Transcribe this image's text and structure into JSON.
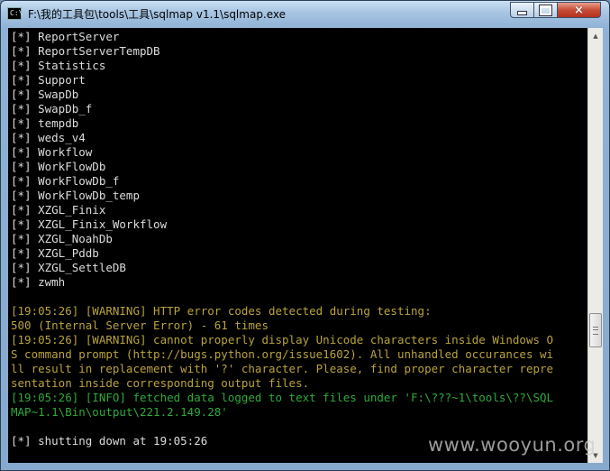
{
  "window": {
    "title": "F:\\我的工具包\\tools\\工具\\sqlmap v1.1\\sqlmap.exe",
    "icon_text": "C:\\",
    "buttons": {
      "minimize": "minimize-icon",
      "maximize": "maximize-icon",
      "close": "×"
    }
  },
  "console": {
    "lines": [
      {
        "text": "[*] ReportServer",
        "type": "normal"
      },
      {
        "text": "[*] ReportServerTempDB",
        "type": "normal"
      },
      {
        "text": "[*] Statistics",
        "type": "normal"
      },
      {
        "text": "[*] Support",
        "type": "normal"
      },
      {
        "text": "[*] SwapDb",
        "type": "normal"
      },
      {
        "text": "[*] SwapDb_f",
        "type": "normal"
      },
      {
        "text": "[*] tempdb",
        "type": "normal"
      },
      {
        "text": "[*] weds_v4",
        "type": "normal"
      },
      {
        "text": "[*] Workflow",
        "type": "normal"
      },
      {
        "text": "[*] WorkFlowDb",
        "type": "normal"
      },
      {
        "text": "[*] WorkFlowDb_f",
        "type": "normal"
      },
      {
        "text": "[*] WorkFlowDb_temp",
        "type": "normal"
      },
      {
        "text": "[*] XZGL_Finix",
        "type": "normal"
      },
      {
        "text": "[*] XZGL_Finix_Workflow",
        "type": "normal"
      },
      {
        "text": "[*] XZGL_NoahDb",
        "type": "normal"
      },
      {
        "text": "[*] XZGL_Pddb",
        "type": "normal"
      },
      {
        "text": "[*] XZGL_SettleDB",
        "type": "normal"
      },
      {
        "text": "[*] zwmh",
        "type": "normal"
      },
      {
        "text": "",
        "type": "normal"
      },
      {
        "text": "[19:05:26] [WARNING] HTTP error codes detected during testing:",
        "type": "warn"
      },
      {
        "text": "500 (Internal Server Error) - 61 times",
        "type": "warn"
      },
      {
        "text": "[19:05:26] [WARNING] cannot properly display Unicode characters inside Windows O",
        "type": "warn"
      },
      {
        "text": "S command prompt (http://bugs.python.org/issue1602). All unhandled occurances wi",
        "type": "warn"
      },
      {
        "text": "ll result in replacement with '?' character. Please, find proper character repre",
        "type": "warn"
      },
      {
        "text": "sentation inside corresponding output files.",
        "type": "warn"
      },
      {
        "text": "[19:05:26] [INFO] fetched data logged to text files under 'F:\\???~1\\tools\\??\\SQL",
        "type": "info"
      },
      {
        "text": "MAP~1.1\\Bin\\output\\221.2.149.28'",
        "type": "info"
      },
      {
        "text": "",
        "type": "normal"
      },
      {
        "text": "[*] shutting down at 19:05:26",
        "type": "normal"
      }
    ]
  },
  "scrollbar": {
    "up_glyph": "▲",
    "down_glyph": "▼"
  },
  "watermark": "www.wooyun.org"
}
